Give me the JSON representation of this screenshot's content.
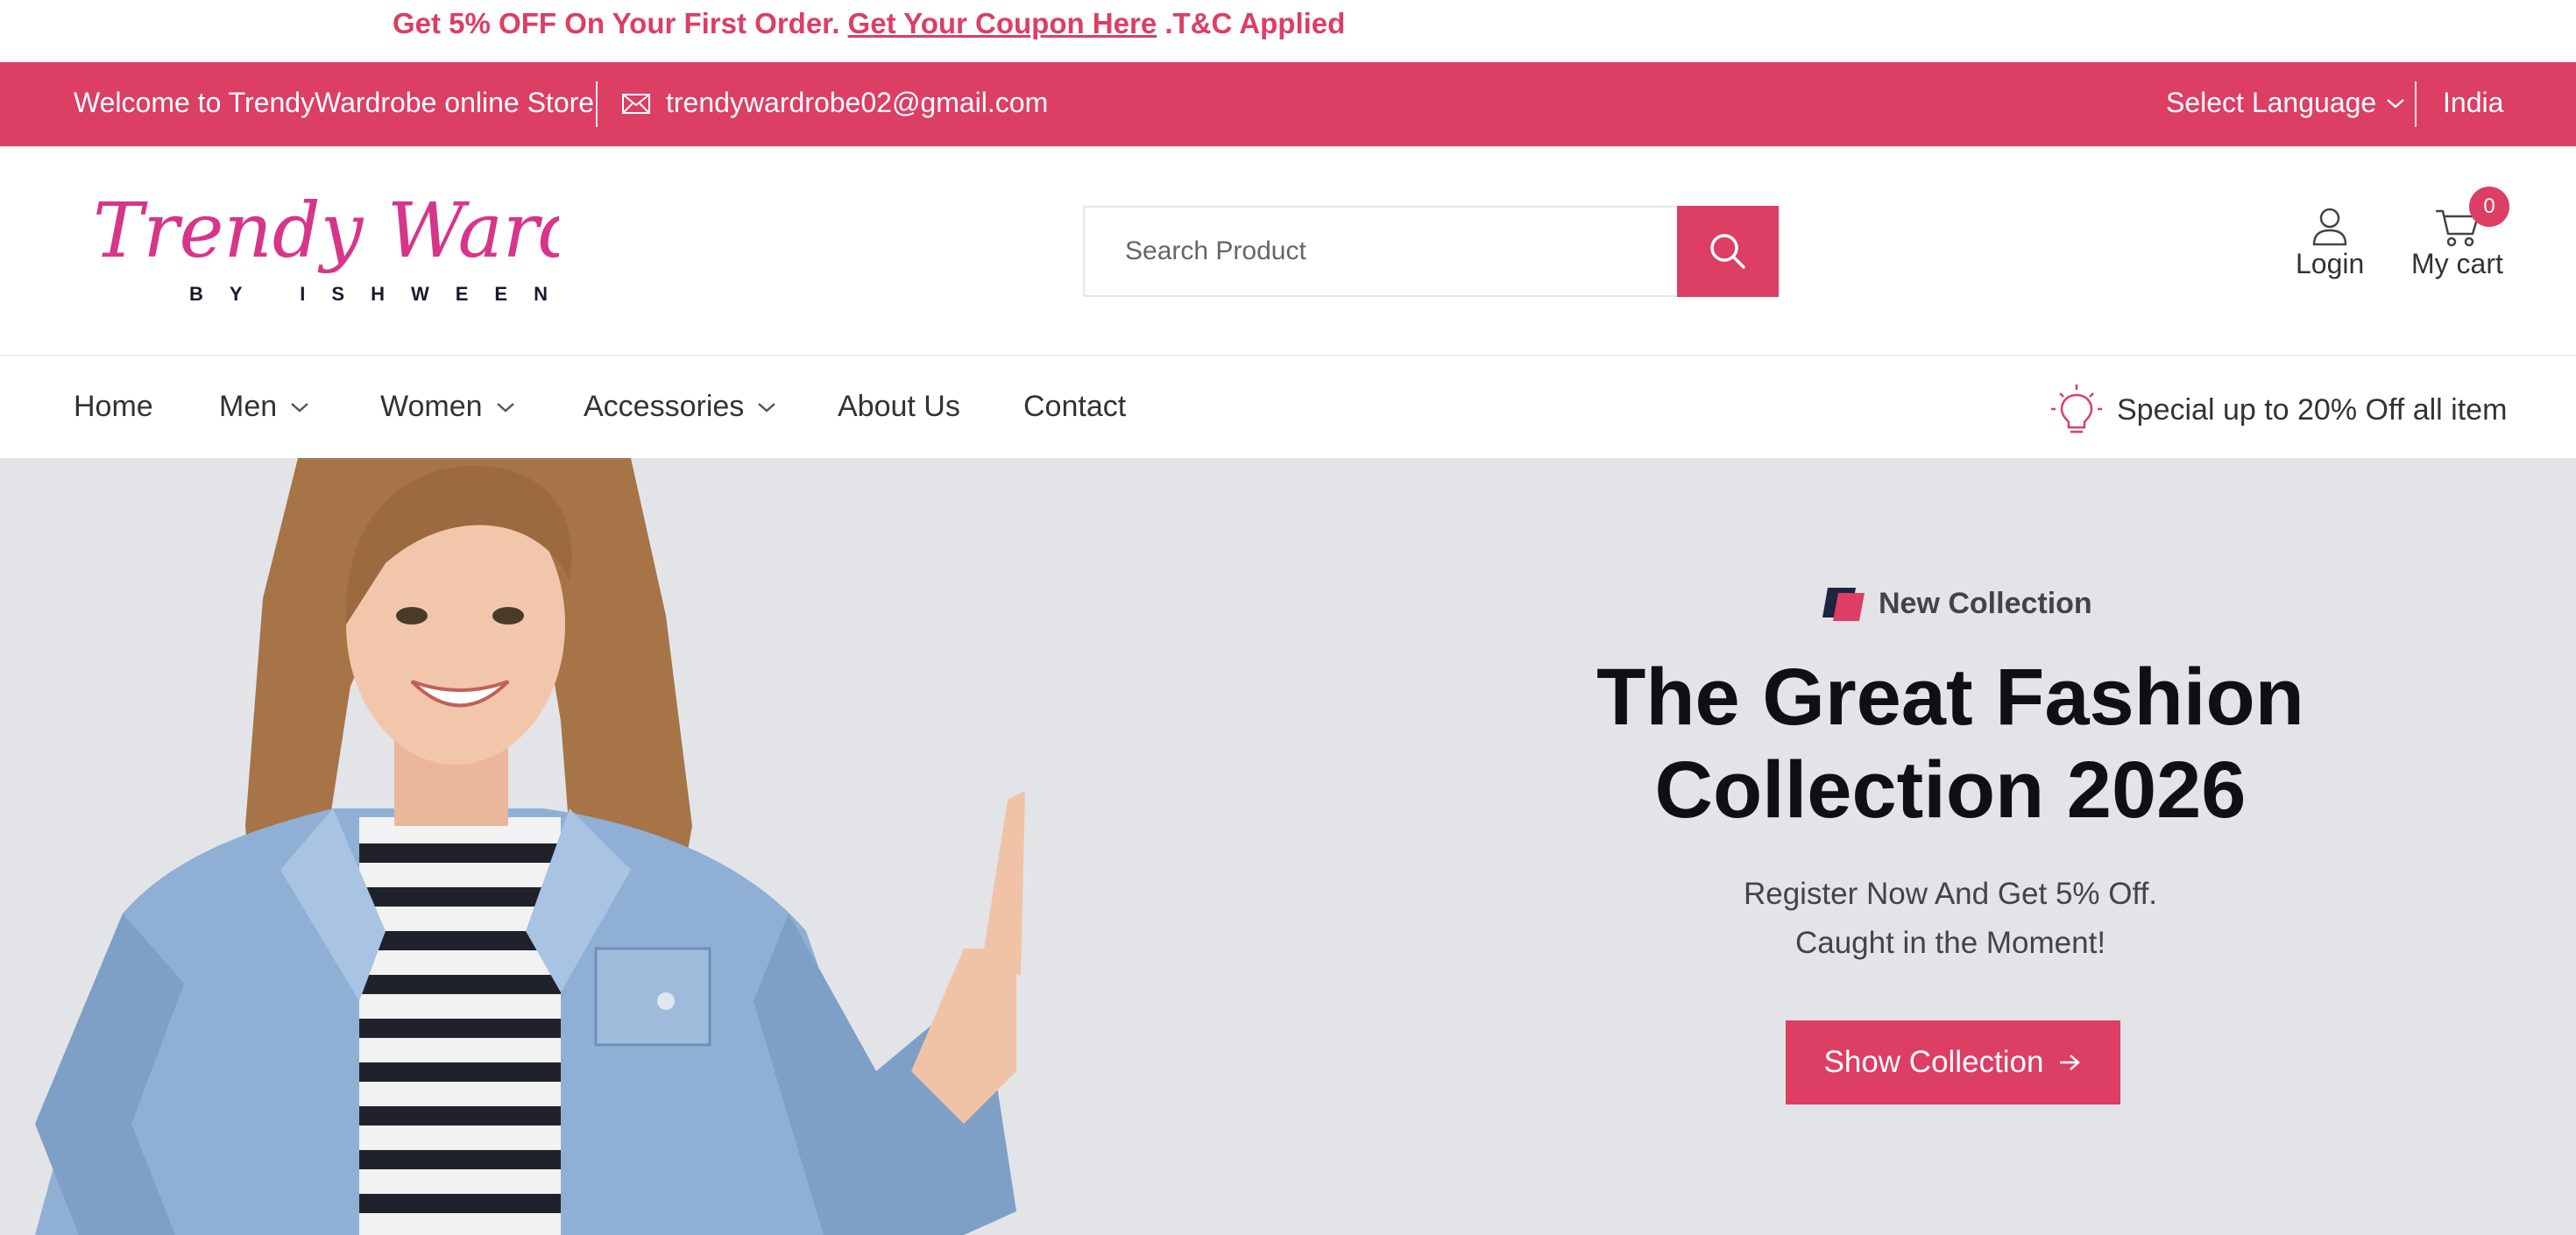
{
  "promo": {
    "lead": "Get 5% OFF On Your First Order.",
    "link": "Get Your Coupon Here",
    "tail": ".T&C Applied"
  },
  "topbar": {
    "welcome": "Welcome to TrendyWardrobe online Store",
    "email": "trendywardrobe02@gmail.com",
    "language": "Select Language",
    "country": "India"
  },
  "header": {
    "logo_script": "Trendy Wardrobe",
    "logo_sub": "BY ISHWEEN",
    "search_placeholder": "Search Product",
    "login_label": "Login",
    "cart_label": "My cart",
    "cart_count": "0"
  },
  "nav": {
    "items": [
      {
        "label": "Home",
        "dropdown": false
      },
      {
        "label": "Men",
        "dropdown": true
      },
      {
        "label": "Women",
        "dropdown": true
      },
      {
        "label": "Accessories",
        "dropdown": true
      },
      {
        "label": "About Us",
        "dropdown": false
      },
      {
        "label": "Contact",
        "dropdown": false
      }
    ],
    "offer": "Special up to 20% Off all item"
  },
  "hero": {
    "tag": "New Collection",
    "title_line1": "The Great Fashion",
    "title_line2": "Collection 2026",
    "sub_line1": "Register Now And Get 5% Off.",
    "sub_line2": "Caught in the Moment!",
    "button": "Show Collection"
  },
  "colors": {
    "accent": "#dc3e64",
    "hero_bg": "#e2e4e8",
    "text_dark": "#0f0f14"
  }
}
